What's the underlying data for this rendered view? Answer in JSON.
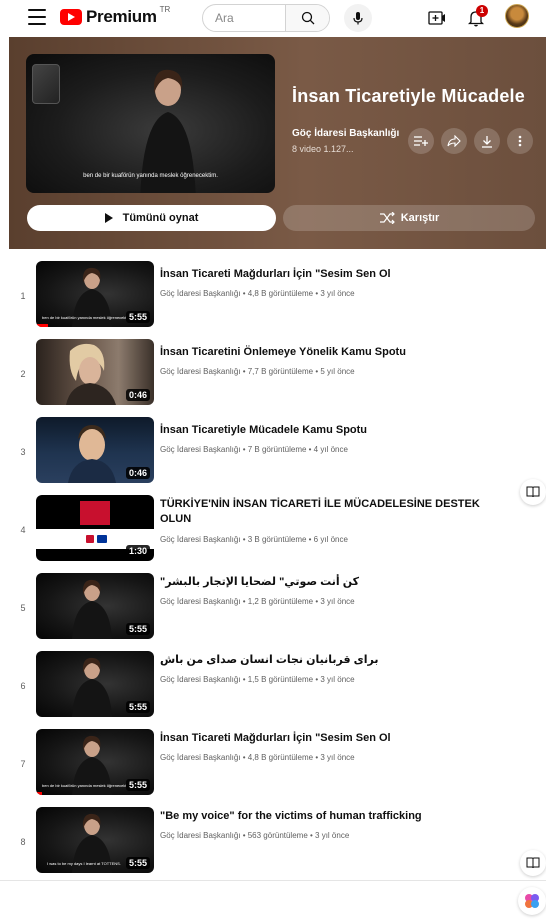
{
  "topbar": {
    "logo_text": "Premium",
    "logo_region": "TR",
    "search_placeholder": "Ara",
    "notification_count": "1"
  },
  "playlist": {
    "title": "İnsan Ticaretiyle Mücadele",
    "channel": "Göç İdaresi Başkanlığı",
    "meta": "8 video  1.127...",
    "hero_caption": "ben de bir kuaförün yanında meslek öğrenecektim.",
    "play_all_label": "Tümünü oynat",
    "shuffle_label": "Karıştır"
  },
  "videos": [
    {
      "index": "1",
      "title": "İnsan Ticareti Mağdurları İçin \"Sesim Sen Ol",
      "meta": "Göç İdaresi Başkanlığı • 4,8 B görüntüleme • 3 yıl önce",
      "duration": "5:55",
      "progress": 0.1
    },
    {
      "index": "2",
      "title": "İnsan Ticaretini Önlemeye Yönelik Kamu Spotu",
      "meta": "Göç İdaresi Başkanlığı • 7,7 B görüntüleme • 5 yıl önce",
      "duration": "0:46",
      "progress": 0
    },
    {
      "index": "3",
      "title": "İnsan Ticaretiyle Mücadele Kamu Spotu",
      "meta": "Göç İdaresi Başkanlığı • 7 B görüntüleme • 4 yıl önce",
      "duration": "0:46",
      "progress": 0
    },
    {
      "index": "4",
      "title": "TÜRKİYE'NİN İNSAN TİCARETİ İLE MÜCADELESİNE DESTEK OLUN",
      "meta": "Göç İdaresi Başkanlığı • 3 B görüntüleme • 6 yıl önce",
      "duration": "1:30",
      "progress": 0
    },
    {
      "index": "5",
      "title": "كن أنت صوتي\" لضحايا الإتجار بالبشر\"",
      "meta": "Göç İdaresi Başkanlığı • 1,2 B görüntüleme • 3 yıl önce",
      "duration": "5:55",
      "progress": 0
    },
    {
      "index": "6",
      "title": "برای قربانیان نجات انسان صدای من باش",
      "meta": "Göç İdaresi Başkanlığı • 1,5 B görüntüleme • 3 yıl önce",
      "duration": "5:55",
      "progress": 0
    },
    {
      "index": "7",
      "title": "İnsan Ticareti Mağdurları İçin \"Sesim Sen Ol",
      "meta": "Göç İdaresi Başkanlığı • 4,8 B görüntüleme • 3 yıl önce",
      "duration": "5:55",
      "progress": 0.05
    },
    {
      "index": "8",
      "title": "\"Be my voice\" for the victims of human trafficking",
      "meta": "Göç İdaresi Başkanlığı • 563 görüntüleme • 3 yıl önce",
      "duration": "5:55",
      "progress": 0
    }
  ],
  "colors": {
    "header_bg": "#6c4f3d",
    "brand_red": "#ff0000",
    "progress_red": "#ff0000"
  }
}
